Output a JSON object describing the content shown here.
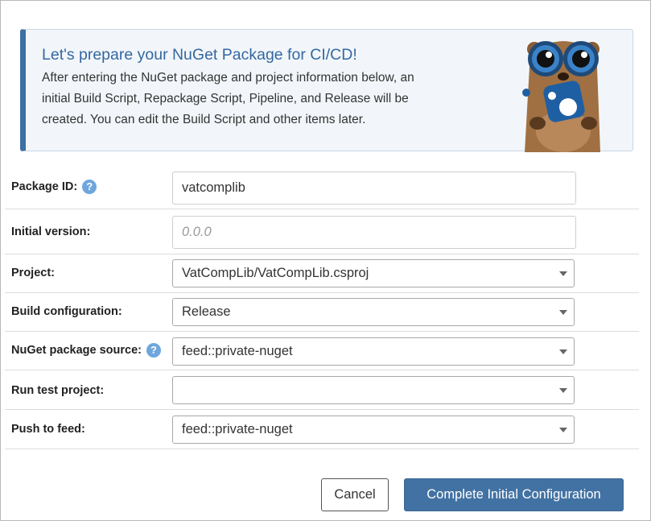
{
  "callout": {
    "title": "Let's prepare your NuGet Package for CI/CD!",
    "line1": "After entering the NuGet package and project information below, an",
    "line2": "initial Build Script, Repackage Script, Pipeline, and Release will be",
    "line3": "created. You can edit the Build Script and other items later."
  },
  "form": {
    "package_id": {
      "label": "Package ID:",
      "value": "vatcomplib",
      "help": "?"
    },
    "initial_version": {
      "label": "Initial version:",
      "placeholder": "0.0.0"
    },
    "project": {
      "label": "Project:",
      "value": "VatCompLib/VatCompLib.csproj"
    },
    "build_configuration": {
      "label": "Build configuration:",
      "value": "Release"
    },
    "nuget_source": {
      "label": "NuGet package source:",
      "value": "feed::private-nuget",
      "help": "?"
    },
    "run_test_project": {
      "label": "Run test project:",
      "value": ""
    },
    "push_to_feed": {
      "label": "Push to feed:",
      "value": "feed::private-nuget"
    }
  },
  "actions": {
    "cancel_label": "Cancel",
    "complete_label": "Complete Initial Configuration"
  },
  "colors": {
    "accent": "#3e6fa0",
    "primary_button": "#4272a3",
    "help_icon": "#6fa6dc"
  },
  "icons": {
    "mascot": "otter-mascot-icon",
    "help": "question-circle-icon",
    "dropdown": "chevron-down-icon"
  }
}
